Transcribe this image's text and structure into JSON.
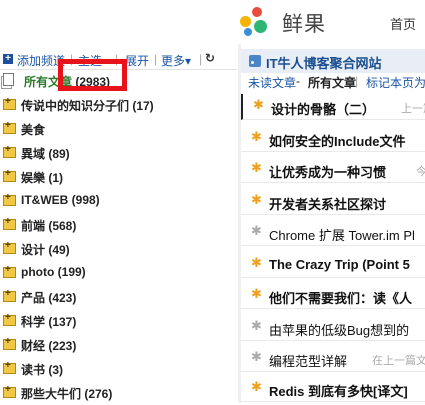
{
  "header": {
    "logo_text": "鲜果",
    "home_link": "首页"
  },
  "left_toolbar": {
    "add_feed": "添加频道",
    "sep1": "|",
    "subscribe": "主造",
    "sep2": "|",
    "expand": "展开",
    "sep3": "|",
    "more": "更多▾",
    "sep4": "|"
  },
  "all_articles": {
    "label": "所有文章",
    "count": "(2983)"
  },
  "folders": [
    {
      "label": "传说中的知识分子们 (17)"
    },
    {
      "label": "美食"
    },
    {
      "label": "異域 (89)"
    },
    {
      "label": "娱樂 (1)"
    },
    {
      "label": "IT&WEB (998)"
    },
    {
      "label": "前端 (568)"
    },
    {
      "label": "设计 (49)"
    },
    {
      "label": "photo (199)"
    },
    {
      "label": "产品 (423)"
    },
    {
      "label": "科学 (137)"
    },
    {
      "label": "财经 (223)"
    },
    {
      "label": "读书 (3)"
    },
    {
      "label": "那些大牛们 (276)"
    }
  ],
  "right": {
    "site_title": "IT牛人博客聚合网站",
    "filter": {
      "unread": "未读文章",
      "dash": " - ",
      "all": "所有文章",
      "sep": " | ",
      "mark": "标记本页为"
    },
    "articles": [
      {
        "title": "设计的骨骼（二）",
        "extra": "上一篇",
        "starred": true,
        "bold": true
      },
      {
        "title": "如何安全的Include文件",
        "extra": "",
        "starred": true,
        "bold": true
      },
      {
        "title": "让优秀成为一种习惯",
        "extra": "今",
        "starred": true,
        "bold": true
      },
      {
        "title": "开发者关系社区探讨",
        "extra": "",
        "starred": true,
        "bold": true
      },
      {
        "title": "Chrome 扩展 Tower.im Pl",
        "extra": "",
        "starred": false,
        "bold": false
      },
      {
        "title": "The Crazy Trip (Point 5",
        "extra": "",
        "starred": true,
        "bold": true
      },
      {
        "title": "他们不需要我们：读《人",
        "extra": "",
        "starred": true,
        "bold": true
      },
      {
        "title": "由苹果的低级Bug想到的",
        "extra": "",
        "starred": false,
        "bold": false
      },
      {
        "title": "编程范型详解",
        "extra": "在上一篇文",
        "starred": false,
        "bold": false
      },
      {
        "title": "Redis 到底有多快[译文]",
        "extra": "",
        "starred": true,
        "bold": true
      }
    ]
  },
  "colors": {
    "highlight": "#e8131a",
    "accent": "#1a55a6",
    "star": "#f0a020"
  }
}
